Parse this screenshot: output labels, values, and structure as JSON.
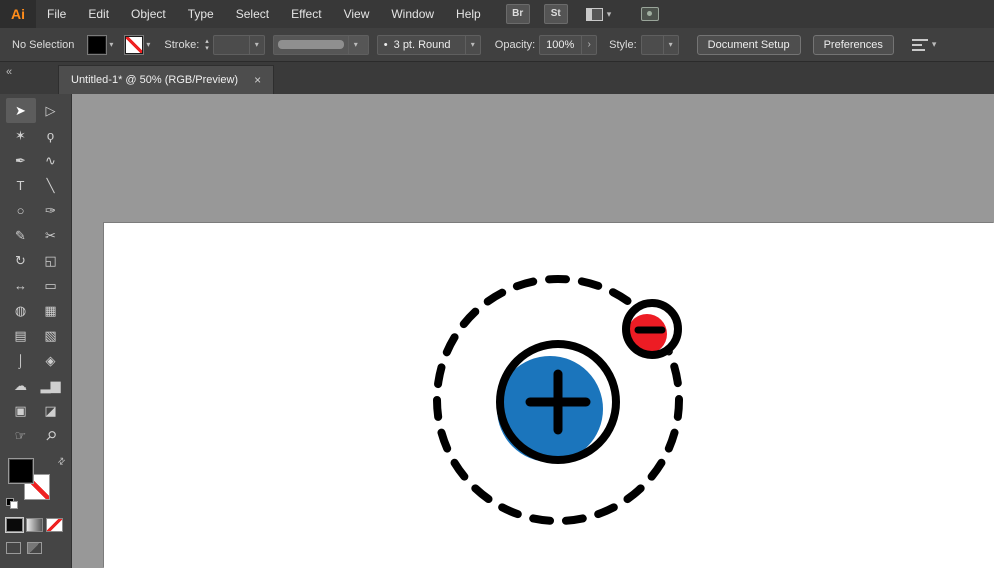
{
  "app": {
    "logo_text": "Ai"
  },
  "colors": {
    "accent_orange": "#ff8c1a",
    "artwork_blue": "#1b75bc",
    "artwork_red": "#ed1c24",
    "artwork_black": "#000000",
    "canvas_gray": "#989898",
    "artboard_white": "#ffffff"
  },
  "icons": {
    "chevron_down": "▾",
    "chevron_up": "▴",
    "chevron_right": "›",
    "double_chevron_left": "«",
    "close": "×",
    "swap": "⇄",
    "bullet": "•"
  },
  "menubar": {
    "items": [
      "File",
      "Edit",
      "Object",
      "Type",
      "Select",
      "Effect",
      "View",
      "Window",
      "Help"
    ],
    "bridge_label": "Br",
    "stock_label": "St"
  },
  "control_bar": {
    "no_selection_label": "No Selection",
    "stroke_label": "Stroke:",
    "stroke_weight_value": "",
    "brush_value": "3 pt. Round",
    "opacity_label": "Opacity:",
    "opacity_value": "100%",
    "style_label": "Style:",
    "document_setup_label": "Document Setup",
    "preferences_label": "Preferences"
  },
  "tabbar": {
    "tab_title": "Untitled-1* @ 50% (RGB/Preview)"
  },
  "toolbar": {
    "tools": [
      {
        "name": "selection-tool",
        "glyph": "➤"
      },
      {
        "name": "direct-selection-tool",
        "glyph": "▷"
      },
      {
        "name": "magic-wand-tool",
        "glyph": "✶"
      },
      {
        "name": "lasso-tool",
        "glyph": "ϙ"
      },
      {
        "name": "pen-tool",
        "glyph": "✒"
      },
      {
        "name": "curvature-tool",
        "glyph": "∿"
      },
      {
        "name": "type-tool",
        "glyph": "T"
      },
      {
        "name": "line-segment-tool",
        "glyph": "╲"
      },
      {
        "name": "ellipse-tool",
        "glyph": "○"
      },
      {
        "name": "paintbrush-tool",
        "glyph": "✑"
      },
      {
        "name": "pencil-tool",
        "glyph": "✎"
      },
      {
        "name": "scissors-tool",
        "glyph": "✂"
      },
      {
        "name": "rotate-tool",
        "glyph": "↻"
      },
      {
        "name": "scale-tool",
        "glyph": "◱"
      },
      {
        "name": "width-tool",
        "glyph": "↔"
      },
      {
        "name": "free-transform-tool",
        "glyph": "▭"
      },
      {
        "name": "shape-builder-tool",
        "glyph": "◍"
      },
      {
        "name": "perspective-grid-tool",
        "glyph": "▦"
      },
      {
        "name": "mesh-tool",
        "glyph": "▤"
      },
      {
        "name": "gradient-tool",
        "glyph": "▧"
      },
      {
        "name": "eyedropper-tool",
        "glyph": "⌡"
      },
      {
        "name": "blend-tool",
        "glyph": "◈"
      },
      {
        "name": "symbol-sprayer-tool",
        "glyph": "☁"
      },
      {
        "name": "column-graph-tool",
        "glyph": "▂▆"
      },
      {
        "name": "artboard-tool",
        "glyph": "▣"
      },
      {
        "name": "slice-tool",
        "glyph": "◪"
      },
      {
        "name": "hand-tool",
        "glyph": "☞"
      },
      {
        "name": "zoom-tool",
        "glyph": "⚲"
      }
    ]
  },
  "artwork": {
    "type": "atom-icon",
    "orbit": {
      "stroke": "#000000",
      "style": "dashed"
    },
    "nucleus": {
      "fill": "#1b75bc",
      "stroke": "#000000",
      "symbol": "+"
    },
    "electron": {
      "fill": "#ed1c24",
      "stroke": "#000000",
      "symbol": "−"
    }
  }
}
